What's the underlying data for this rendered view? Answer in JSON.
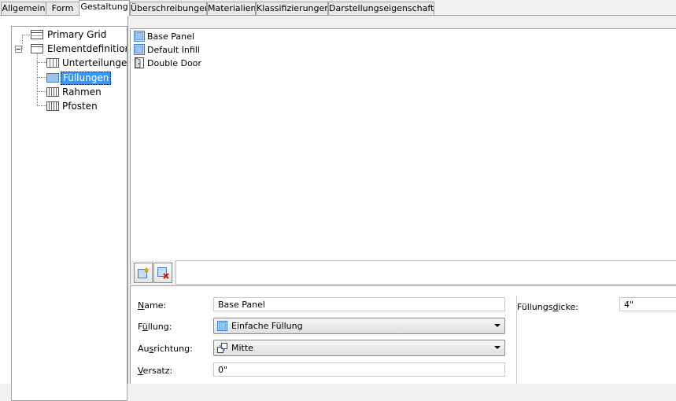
{
  "tabs": [
    {
      "label": "Allgemein",
      "active": false
    },
    {
      "label": "Form",
      "active": false
    },
    {
      "label": "Gestaltung",
      "active": true
    },
    {
      "label": "Überschreibungen",
      "active": false
    },
    {
      "label": "Materialien",
      "active": false
    },
    {
      "label": "Klassifizierungen",
      "active": false
    },
    {
      "label": "Darstellungseigenschaften",
      "active": false
    }
  ],
  "tree": {
    "primary_grid": "Primary Grid",
    "element_definitions": "Elementdefinitione",
    "children": [
      {
        "label": "Unterteilungen",
        "icon": "division-icon",
        "selected": false
      },
      {
        "label": "Füllungen",
        "icon": "infill-icon",
        "selected": true
      },
      {
        "label": "Rahmen",
        "icon": "frame-icon",
        "selected": false
      },
      {
        "label": "Pfosten",
        "icon": "mullion-icon",
        "selected": false
      }
    ]
  },
  "list": {
    "items": [
      {
        "label": "Base Panel",
        "icon": "panel-icon",
        "selected": true
      },
      {
        "label": "Default Infill",
        "icon": "panel-icon",
        "selected": false
      },
      {
        "label": "Double Door",
        "icon": "door-icon",
        "selected": false
      }
    ]
  },
  "toolbar": {
    "add_icon": "new-item-icon",
    "delete_icon": "delete-item-icon"
  },
  "props": {
    "name_label_pre": "",
    "name_label_u": "N",
    "name_label_post": "ame:",
    "name_value": "Base Panel",
    "fill_label_pre": "F",
    "fill_label_u": "ü",
    "fill_label_post": "llung:",
    "fill_value": "Einfache Füllung",
    "align_label_pre": "Au",
    "align_label_u": "s",
    "align_label_post": "richtung:",
    "align_value": "Mitte",
    "offset_label_pre": "",
    "offset_label_u": "V",
    "offset_label_post": "ersatz:",
    "offset_value": "0\"",
    "thickness_label_pre": "Füllungs",
    "thickness_label_u": "d",
    "thickness_label_post": "icke:",
    "thickness_value": "4\""
  }
}
